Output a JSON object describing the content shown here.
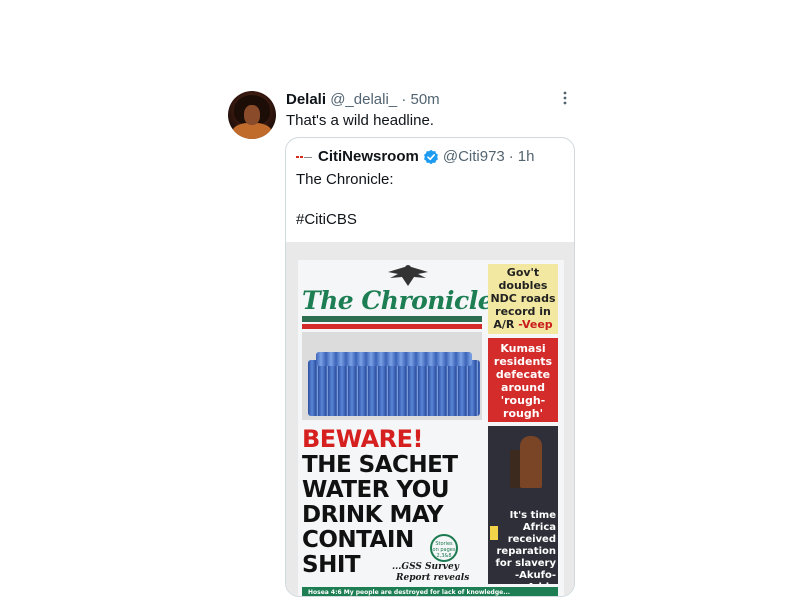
{
  "tweet": {
    "author_name": "Delali",
    "author_handle": "@_delali_",
    "separator": "·",
    "time": "50m",
    "more_icon": "more-dots-icon",
    "text": "That's a wild headline."
  },
  "quoted_tweet": {
    "author_name": "CitiNewsroom",
    "verified": true,
    "verified_color": "#1d9bf0",
    "author_handle": "@Citi973",
    "separator": "·",
    "time": "1h",
    "text": "The Chronicle:\n\n#CitiCBS"
  },
  "newspaper": {
    "masthead": "The Chronicle",
    "headline_red": "BEWARE!",
    "headline_black": "THE SACHET\nWATER YOU\nDRINK MAY\nCONTAIN\nSHIT",
    "subhead_1": "...GSS Survey",
    "subhead_2": "Report reveals",
    "stamp": "Stories on pages 2,3&8",
    "box1_text": "Gov't doubles NDC roads record in A/R",
    "box1_tag": "-Veep",
    "box2_text": "Kumasi residents defecate around 'rough-rough'",
    "box3_text": "It's time Africa received reparation for slavery -Akufo-Addo",
    "footer": "Hosea 4:6   My people are destroyed for lack of knowledge..."
  }
}
